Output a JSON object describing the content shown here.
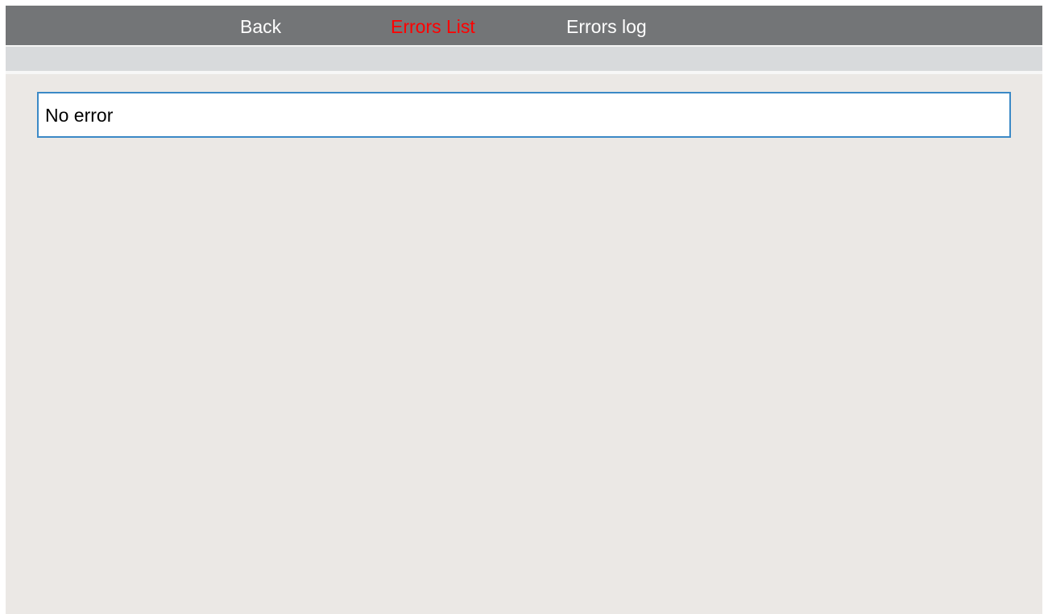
{
  "nav": {
    "back_label": "Back",
    "errors_list_label": "Errors List",
    "errors_log_label": "Errors log",
    "active_tab": "Errors List"
  },
  "errors": {
    "message": "No error"
  },
  "colors": {
    "nav_background": "#737577",
    "nav_text": "#ffffff",
    "active_tab_text": "#ff0000",
    "subbar_background": "#d8dadc",
    "page_background": "#ebe8e5",
    "error_box_border": "#3b89c6"
  }
}
